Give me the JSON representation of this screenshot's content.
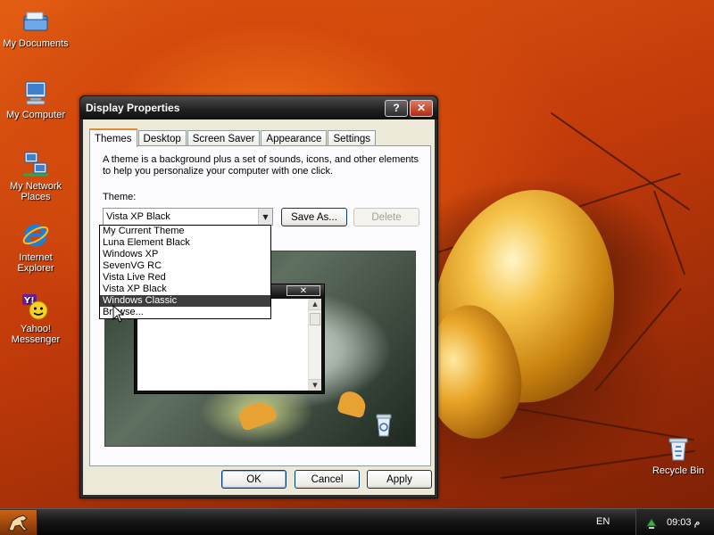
{
  "desktop": {
    "icons": [
      {
        "label": "My Documents",
        "icon": "my-documents-icon"
      },
      {
        "label": "My Computer",
        "icon": "my-computer-icon"
      },
      {
        "label_line1": "My Network",
        "label_line2": "Places",
        "icon": "network-places-icon"
      },
      {
        "label_line1": "Internet",
        "label_line2": "Explorer",
        "icon": "internet-explorer-icon"
      },
      {
        "label_line1": "Yahoo!",
        "label_line2": "Messenger",
        "icon": "yahoo-messenger-icon"
      },
      {
        "label": "Recycle Bin",
        "icon": "recycle-bin-icon"
      }
    ]
  },
  "window": {
    "title": "Display Properties",
    "help_label": "?",
    "close_label": "✕",
    "tabs": [
      "Themes",
      "Desktop",
      "Screen Saver",
      "Appearance",
      "Settings"
    ],
    "active_tab": "Themes",
    "description": "A theme is a background plus a set of sounds, icons, and other elements to help you personalize your computer with one click.",
    "theme_label": "Theme:",
    "theme_value": "Vista XP Black",
    "save_as_label": "Save As...",
    "delete_label": "Delete",
    "ok_label": "OK",
    "cancel_label": "Cancel",
    "apply_label": "Apply"
  },
  "dropdown": {
    "items": [
      "My Current Theme",
      "Luna Element Black",
      "Windows XP",
      "SevenVG RC",
      "Vista Live Red",
      "Vista XP Black",
      "Windows Classic",
      "Browse..."
    ],
    "highlighted": "Windows Classic"
  },
  "preview": {
    "mini_close_label": "✕"
  },
  "taskbar": {
    "language": "EN",
    "clock": "09:03 م"
  },
  "colors": {
    "selection": "#3d3d3d",
    "titlebar": "#1f1f1f",
    "tab_accent": "#e68b2c",
    "wallpaper": "#d44a0c"
  }
}
